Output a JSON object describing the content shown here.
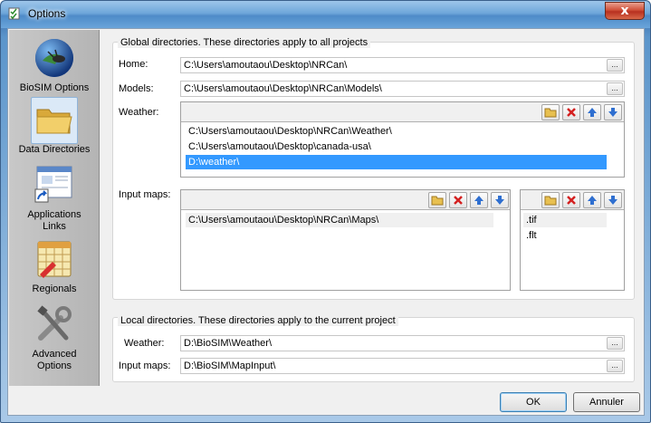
{
  "window": {
    "title": "Options",
    "close_label": "x"
  },
  "sidebar": {
    "items": [
      {
        "label": "BioSIM Options",
        "icon": "biosim-logo-icon"
      },
      {
        "label": "Data Directories",
        "icon": "folder-icon"
      },
      {
        "label": "Applications Links",
        "icon": "app-window-shortcut-icon"
      },
      {
        "label": "Regionals",
        "icon": "calendar-grid-icon"
      },
      {
        "label": "Advanced Options",
        "icon": "tools-icon"
      }
    ],
    "selected_index": 1
  },
  "global": {
    "title": "Global directories. These directories apply to all projects",
    "home_label": "Home:",
    "home_value": "C:\\Users\\amoutaou\\Desktop\\NRCan\\",
    "models_label": "Models:",
    "models_value": "C:\\Users\\amoutaou\\Desktop\\NRCan\\Models\\",
    "weather_label": "Weather:",
    "weather_items": [
      "C:\\Users\\amoutaou\\Desktop\\NRCan\\Weather\\",
      "C:\\Users\\amoutaou\\Desktop\\canada-usa\\",
      "D:\\weather\\"
    ],
    "weather_selected_index": 2,
    "input_maps_label": "Input maps:",
    "input_maps_items": [
      "C:\\Users\\amoutaou\\Desktop\\NRCan\\Maps\\"
    ],
    "extensions": [
      ".tif",
      ".flt"
    ],
    "browse_label": "..."
  },
  "local": {
    "title": "Local directories. These directories apply to the current project",
    "weather_label": "Weather:",
    "weather_value": "D:\\BioSIM\\Weather\\",
    "input_maps_label": "Input maps:",
    "input_maps_value": "D:\\BioSIM\\MapInput\\"
  },
  "buttons": {
    "ok": "OK",
    "cancel": "Annuler"
  },
  "colors": {
    "selection": "#3399ff",
    "delete": "#d42020",
    "arrow": "#2f6fd0",
    "folder": "#e8c050"
  }
}
